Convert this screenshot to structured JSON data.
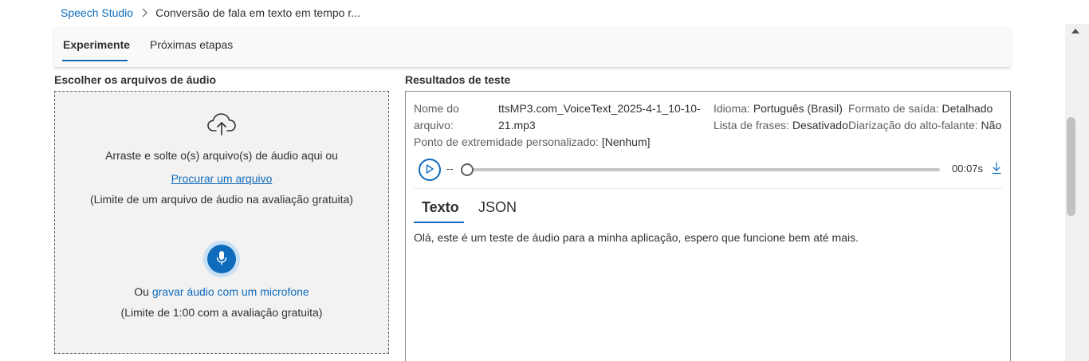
{
  "breadcrumb": {
    "root": "Speech Studio",
    "current": "Conversão de fala em texto em tempo r..."
  },
  "tabs": [
    {
      "label": "Experimente",
      "active": true
    },
    {
      "label": "Próximas etapas",
      "active": false
    }
  ],
  "upload": {
    "title": "Escolher os arquivos de áudio",
    "drag_text": "Arraste e solte o(s) arquivo(s) de áudio aqui ou",
    "browse_link": "Procurar um arquivo",
    "file_limit": "(Limite de um arquivo de áudio na avaliação gratuita)",
    "or_text": "Ou",
    "record_link": "gravar áudio com um microfone",
    "record_limit": "(Limite de 1:00 com a avaliação gratuita)",
    "icons": [
      "cloud-upload-icon",
      "microphone-icon"
    ]
  },
  "results": {
    "title": "Resultados de teste",
    "file_name_label_1": "Nome do",
    "file_name_label_2": "arquivo:",
    "file_name_value_1": "ttsMP3.com_VoiceText_2025-4-1_10-10-",
    "file_name_value_2": "21.mp3",
    "language_label": "Idioma:",
    "language_value": "Português (Brasil)",
    "phrase_list_label": "Lista de frases:",
    "phrase_list_value": "Desativado",
    "output_format_label": "Formato de saída:",
    "output_format_value": "Detalhado",
    "diarization_label": "Diarização do alto-falante:",
    "diarization_value": "Não",
    "endpoint_label": "Ponto de extremidade personalizado:",
    "endpoint_value": "[Nenhum]",
    "player": {
      "current_time": "--",
      "duration": "00:07s",
      "progress": 0
    },
    "tabs": [
      {
        "label": "Texto",
        "active": true
      },
      {
        "label": "JSON",
        "active": false
      }
    ],
    "transcript": "Olá, este é um teste de áudio para a minha aplicação, espero que funcione bem até mais."
  },
  "colors": {
    "accent": "#0f6cbd",
    "text": "#323130",
    "secondary_text": "#605e5c",
    "dropzone_bg": "#f3f2f1"
  }
}
